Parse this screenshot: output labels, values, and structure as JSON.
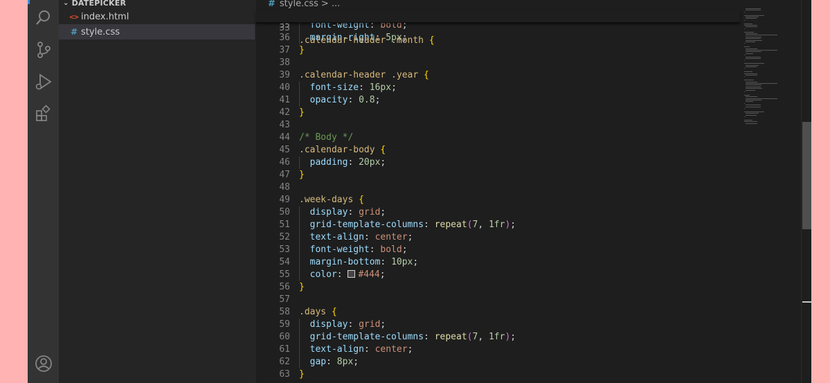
{
  "explorer": {
    "folder_name": "DATEPICKER",
    "files": [
      {
        "name": "index.html",
        "icon": "html-file-icon",
        "active": false
      },
      {
        "name": "style.css",
        "icon": "css-file-icon",
        "active": true
      }
    ]
  },
  "activity_bar": {
    "icons": [
      "search-icon",
      "source-control-icon",
      "run-debug-icon",
      "extensions-icon",
      "account-icon"
    ]
  },
  "breadcrumb": {
    "file": "style.css",
    "separator": ">",
    "rest": "..."
  },
  "sticky_line": {
    "number": "33",
    "text": ".calendar-header .month {"
  },
  "code_lines": [
    {
      "n": "35",
      "text": "  font-weight: bold;"
    },
    {
      "n": "36",
      "text": "  margin-right: 5px;"
    },
    {
      "n": "37",
      "text": "}"
    },
    {
      "n": "38",
      "text": ""
    },
    {
      "n": "39",
      "text": ".calendar-header .year {"
    },
    {
      "n": "40",
      "text": "  font-size: 16px;"
    },
    {
      "n": "41",
      "text": "  opacity: 0.8;"
    },
    {
      "n": "42",
      "text": "}"
    },
    {
      "n": "43",
      "text": ""
    },
    {
      "n": "44",
      "text": "/* Body */"
    },
    {
      "n": "45",
      "text": ".calendar-body {"
    },
    {
      "n": "46",
      "text": "  padding: 20px;"
    },
    {
      "n": "47",
      "text": "}"
    },
    {
      "n": "48",
      "text": ""
    },
    {
      "n": "49",
      "text": ".week-days {"
    },
    {
      "n": "50",
      "text": "  display: grid;"
    },
    {
      "n": "51",
      "text": "  grid-template-columns: repeat(7, 1fr);"
    },
    {
      "n": "52",
      "text": "  text-align: center;"
    },
    {
      "n": "53",
      "text": "  font-weight: bold;"
    },
    {
      "n": "54",
      "text": "  margin-bottom: 10px;"
    },
    {
      "n": "55",
      "text": "  color: #444;"
    },
    {
      "n": "56",
      "text": "}"
    },
    {
      "n": "57",
      "text": ""
    },
    {
      "n": "58",
      "text": ".days {"
    },
    {
      "n": "59",
      "text": "  display: grid;"
    },
    {
      "n": "60",
      "text": "  grid-template-columns: repeat(7, 1fr);"
    },
    {
      "n": "61",
      "text": "  text-align: center;"
    },
    {
      "n": "62",
      "text": "  gap: 8px;"
    },
    {
      "n": "63",
      "text": "}"
    }
  ],
  "colors": {
    "editor_bg": "#1e1e1e",
    "sidebar_bg": "#252526",
    "activity_bg": "#333333",
    "selector": "#d7ba7d",
    "property": "#9cdcfe",
    "value": "#ce9178",
    "number": "#b5cea8",
    "comment": "#6a9955",
    "brace": "#ffd700",
    "color_swatch": "#444444"
  }
}
